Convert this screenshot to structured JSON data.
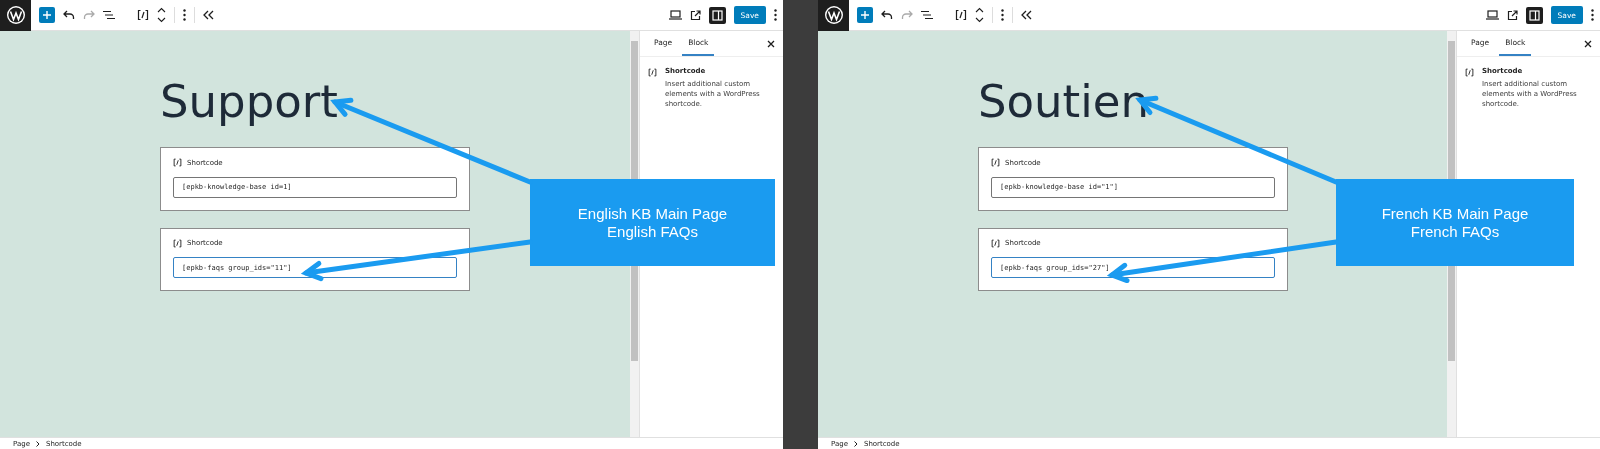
{
  "panels": [
    {
      "toolbar": {
        "save_button": "Save",
        "settings_selected": true
      },
      "title": "Support",
      "blocks": [
        {
          "label": "Shortcode",
          "value": "[epkb-knowledge-base id=1]",
          "selected": false
        },
        {
          "label": "Shortcode",
          "value": "[epkb-faqs group_ids=\"11\"]",
          "selected": true
        }
      ],
      "callout": [
        "English KB Main Page",
        "English FAQs"
      ],
      "sidebar": {
        "tabs": [
          {
            "label": "Page",
            "selected": false
          },
          {
            "label": "Block",
            "selected": true
          }
        ],
        "block_name": "Shortcode",
        "block_description": "Insert additional custom elements with a WordPress shortcode."
      },
      "breadcrumb": [
        "Page",
        "Shortcode"
      ]
    },
    {
      "toolbar": {
        "save_button": "Save",
        "settings_selected": true
      },
      "title": "Soutien",
      "blocks": [
        {
          "label": "Shortcode",
          "value": "[epkb-knowledge-base id=\"1\"]",
          "selected": false
        },
        {
          "label": "Shortcode",
          "value": "[epkb-faqs group_ids=\"27\"]",
          "selected": true
        }
      ],
      "callout": [
        "French KB Main Page",
        "French FAQs"
      ],
      "sidebar": {
        "tabs": [
          {
            "label": "Page",
            "selected": false
          },
          {
            "label": "Block",
            "selected": true
          }
        ],
        "block_name": "Shortcode",
        "block_description": "Insert additional custom elements with a WordPress shortcode."
      },
      "breadcrumb": [
        "Page",
        "Shortcode"
      ]
    }
  ]
}
